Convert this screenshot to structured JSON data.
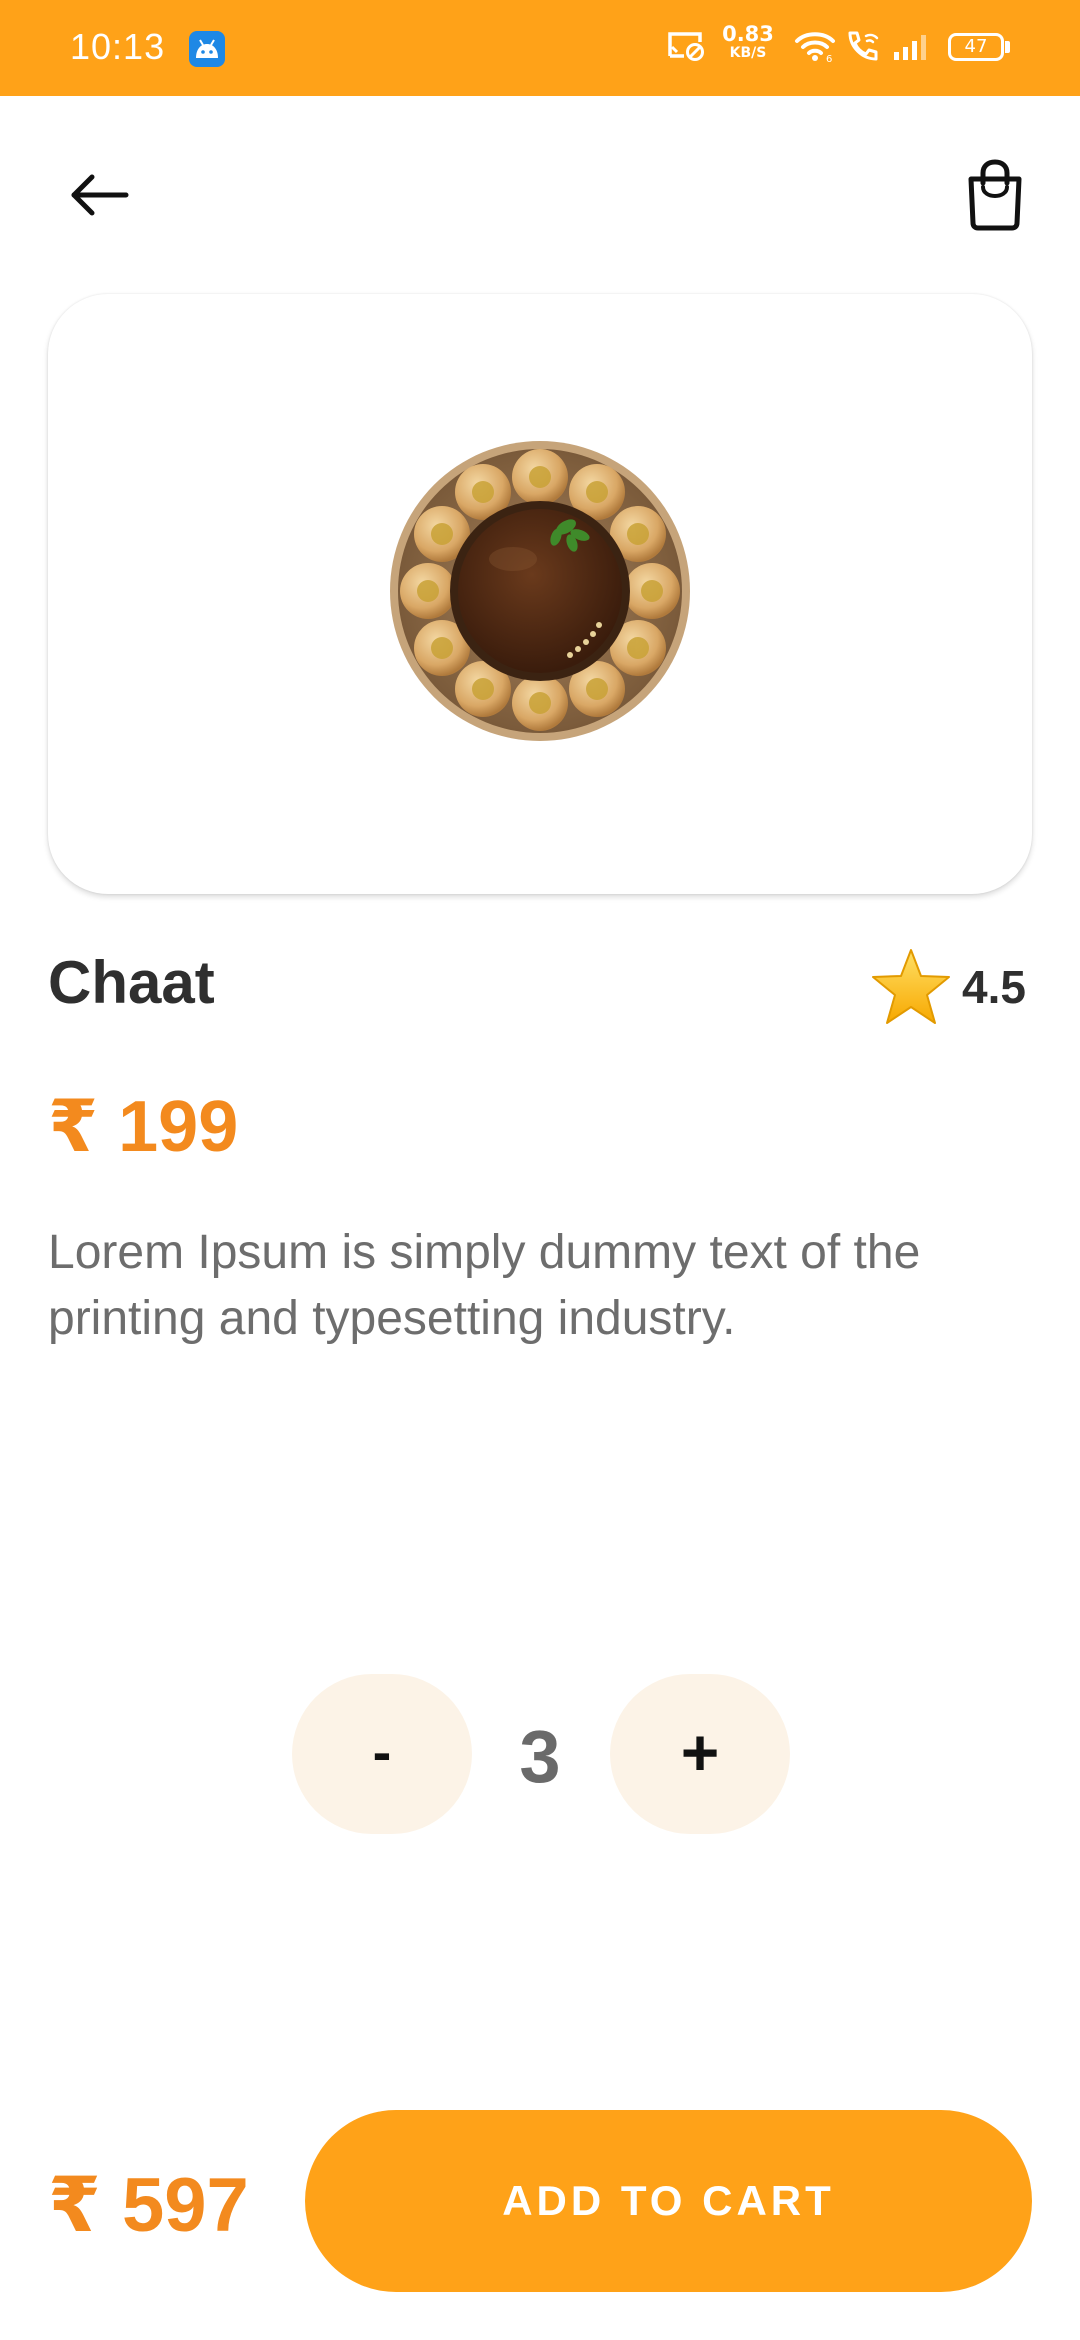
{
  "status_bar": {
    "time": "10:13",
    "net_speed_value": "0.83",
    "net_speed_unit": "KB/S",
    "battery": "47",
    "icons": [
      "android-notification-icon",
      "screen-cast-icon",
      "wifi-icon",
      "wifi-calling-icon",
      "signal-icon",
      "battery-icon"
    ]
  },
  "header": {
    "back_icon": "arrow-left-icon",
    "cart_icon": "shopping-bag-icon"
  },
  "product": {
    "image": "chaat-pani-puri-plate",
    "title": "Chaat",
    "rating": "4.5",
    "rating_icon": "star-icon",
    "price": "₹ 199",
    "description": "Lorem Ipsum is simply dummy text of the printing and typesetting industry."
  },
  "quantity": {
    "decrement_label": "-",
    "value": "3",
    "increment_label": "+"
  },
  "footer": {
    "total": "₹ 597",
    "add_to_cart_label": "ADD TO CART"
  },
  "colors": {
    "accent": "#FFA218",
    "price": "#F38A1E",
    "stepper_bg": "#FCF3E7",
    "title": "#2F2F2F",
    "description": "#6D6D6D"
  }
}
